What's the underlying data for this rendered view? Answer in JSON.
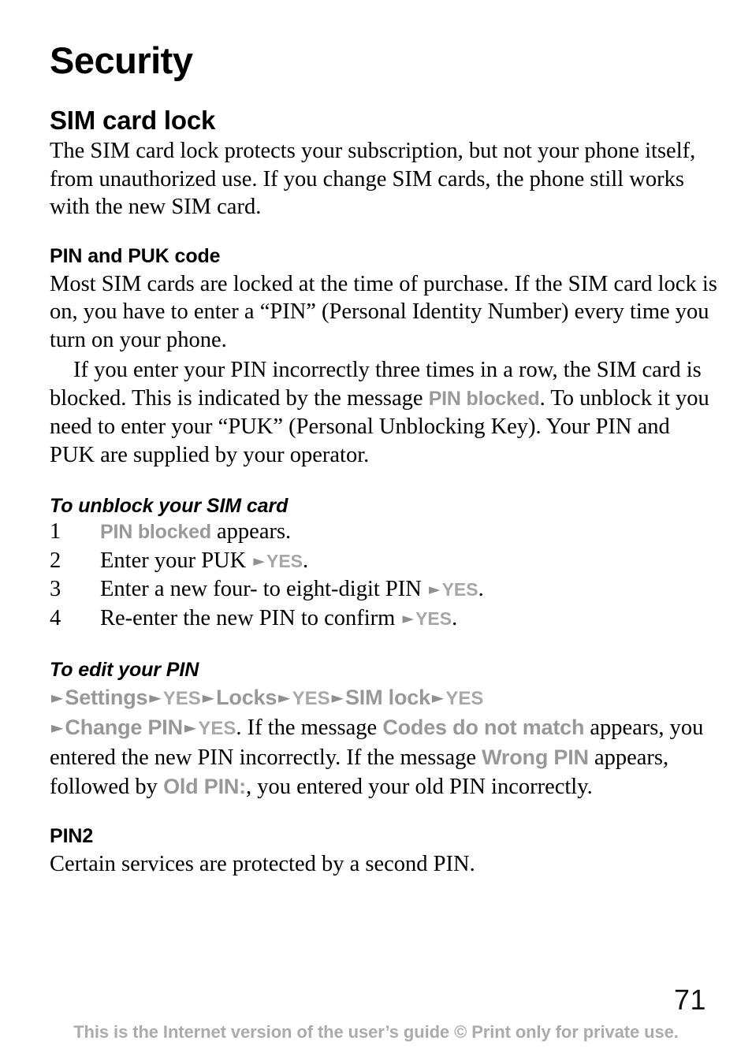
{
  "document": {
    "chapter_title": "Security",
    "page_number": "71",
    "footer_note": "This is the Internet version of the user’s guide © Print only for private use."
  },
  "colors": {
    "ui_label_gray": "#999999",
    "ui_key_gray": "#a6a6a6",
    "arrow_gray": "#8f8f8f",
    "footer_gray": "#ababab",
    "body_text": "#000000"
  },
  "icons": {
    "arrow_right": "►"
  },
  "sections": {
    "sim_card_lock": {
      "heading": "SIM card lock",
      "paragraph": "The SIM card lock protects your subscription, but not your phone itself, from unauthorized use. If you change SIM cards, the phone still works with the new SIM card."
    },
    "pin_and_puk": {
      "heading": "PIN and PUK code",
      "paragraph_1": "Most SIM cards are locked at the time of purchase. If the SIM card lock is on, you have to enter a “PIN” (Personal Identity Number) every time you turn on your phone.",
      "paragraph_2_part_1": "If you enter your PIN incorrectly three times in a row, the SIM card is blocked. This is indicated by the message ",
      "paragraph_2_ui_label": "PIN blocked",
      "paragraph_2_part_2": ". To unblock it you need to enter your “PUK” (Personal Unblocking Key). Your PIN and PUK are supplied by your operator."
    },
    "unblock_sim": {
      "heading": "To unblock your SIM card",
      "steps": [
        {
          "number": "1",
          "ui_label": "PIN blocked",
          "text_after": " appears.",
          "text_before": "",
          "key": "",
          "tail": ""
        },
        {
          "number": "2",
          "ui_label": "",
          "text_before": "Enter your PUK ",
          "key": "YES",
          "tail": ".",
          "text_after": ""
        },
        {
          "number": "3",
          "ui_label": "",
          "text_before": "Enter a new four- to eight-digit PIN ",
          "key": "YES",
          "tail": ".",
          "text_after": ""
        },
        {
          "number": "4",
          "ui_label": "",
          "text_before": "Re-enter the new PIN to confirm ",
          "key": "YES",
          "tail": ".",
          "text_after": ""
        }
      ]
    },
    "edit_pin": {
      "heading": "To edit your PIN",
      "path_line_1": {
        "item_1": "Settings",
        "key_1": "YES",
        "item_2": "Locks",
        "key_2": "YES",
        "item_3": "SIM lock",
        "key_3": "YES"
      },
      "path_line_2": {
        "item_1": "Change PIN",
        "key_1": "YES",
        "text_1": ". If the message ",
        "ui_message_1": "Codes do not match",
        "text_2": " appears, you entered the new PIN incorrectly. If the message ",
        "ui_message_2": "Wrong PIN",
        "text_3": " appears, followed by ",
        "ui_message_3": "Old PIN:",
        "text_4": ", you entered your old PIN incorrectly."
      }
    },
    "pin2": {
      "heading": "PIN2",
      "paragraph": "Certain services are protected by a second PIN."
    }
  }
}
